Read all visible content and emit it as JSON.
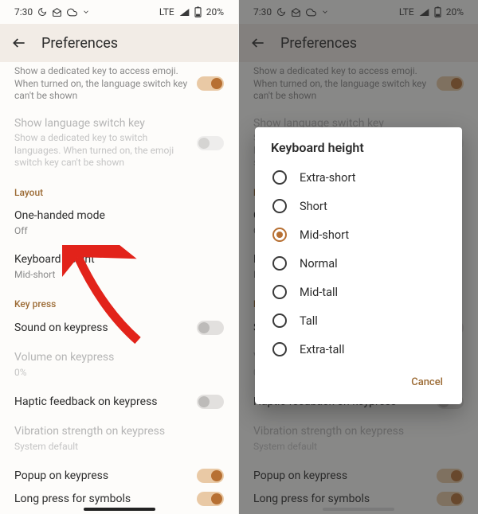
{
  "status": {
    "time": "7:30",
    "network": "LTE",
    "battery": "20%"
  },
  "header": {
    "title": "Preferences"
  },
  "rows": {
    "emoji_trunc": "Show a dedicated key to access emoji. When turned on, the language switch key can't be shown",
    "lang_title": "Show language switch key",
    "lang_sub": "Show a dedicated key to switch languages. When turned on, the emoji switch key can't be shown",
    "section_layout": "Layout",
    "onehand_title": "One-handed mode",
    "onehand_sub": "Off",
    "kbh_title": "Keyboard height",
    "kbh_sub": "Mid-short",
    "section_keypress": "Key press",
    "sound_title": "Sound on keypress",
    "volume_title": "Volume on keypress",
    "volume_sub": "0%",
    "haptic_title": "Haptic feedback on keypress",
    "vib_title": "Vibration strength on keypress",
    "vib_sub": "System default",
    "popup_title": "Popup on keypress",
    "longpress_title": "Long press for symbols"
  },
  "right": {
    "kbh_letter": "K",
    "mid_letter": "M",
    "keypress_letter": "K",
    "s_letter": "S"
  },
  "dialog": {
    "title": "Keyboard height",
    "options": [
      "Extra-short",
      "Short",
      "Mid-short",
      "Normal",
      "Mid-tall",
      "Tall",
      "Extra-tall"
    ],
    "selected_index": 2,
    "cancel": "Cancel"
  }
}
